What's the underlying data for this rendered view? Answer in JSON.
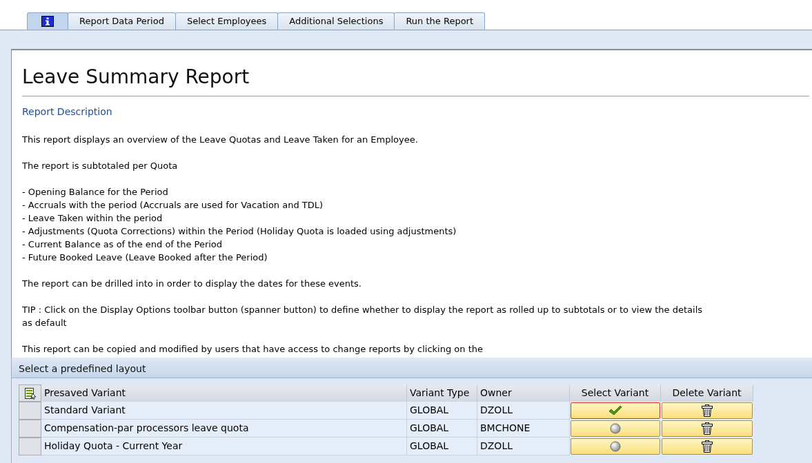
{
  "tabs": [
    {
      "kind": "icon",
      "selected": true
    },
    {
      "kind": "text",
      "label": "Report Data Period",
      "selected": false
    },
    {
      "kind": "text",
      "label": "Select Employees",
      "selected": false
    },
    {
      "kind": "text",
      "label": "Additional Selections",
      "selected": false
    },
    {
      "kind": "text",
      "label": "Run the Report",
      "selected": false
    }
  ],
  "report": {
    "title": "Leave Summary Report",
    "link": "Report Description",
    "paragraphs": [
      [
        "This report displays an overview of the Leave Quotas and Leave Taken for an Employee."
      ],
      [
        "The report is subtotaled per Quota"
      ],
      [
        "- Opening Balance for the Period",
        "- Accruals with the period (Accruals are used for Vacation and TDL)",
        "- Leave Taken within the period",
        "- Adjustments (Quota Corrections) within the Period (Holiday Quota is loaded using adjustments)",
        "- Current Balance as of the end of the Period",
        "- Future Booked Leave (Leave Booked after the Period)"
      ],
      [
        "The report can be drilled into in order to display the dates for these events."
      ],
      [
        "TIP : Click on the Display Options toolbar button (spanner button) to define whether to display the report as rolled up to subtotals or to view the details",
        "as default"
      ],
      [
        "This report can be copied and modified by users that have access to change reports by clicking on the"
      ]
    ]
  },
  "layout_panel": {
    "title": "Select a predefined layout",
    "columns": [
      "Presaved Variant",
      "Variant Type",
      "Owner",
      "Select Variant",
      "Delete Variant"
    ],
    "rows": [
      {
        "variant": "Standard Variant",
        "type": "GLOBAL",
        "owner": "DZOLL",
        "selected": true
      },
      {
        "variant": "Compensation-par processors leave quota",
        "type": "GLOBAL",
        "owner": "BMCHONE",
        "selected": false
      },
      {
        "variant": "Holiday Quota - Current Year",
        "type": "GLOBAL",
        "owner": "DZOLL",
        "selected": false
      }
    ]
  }
}
